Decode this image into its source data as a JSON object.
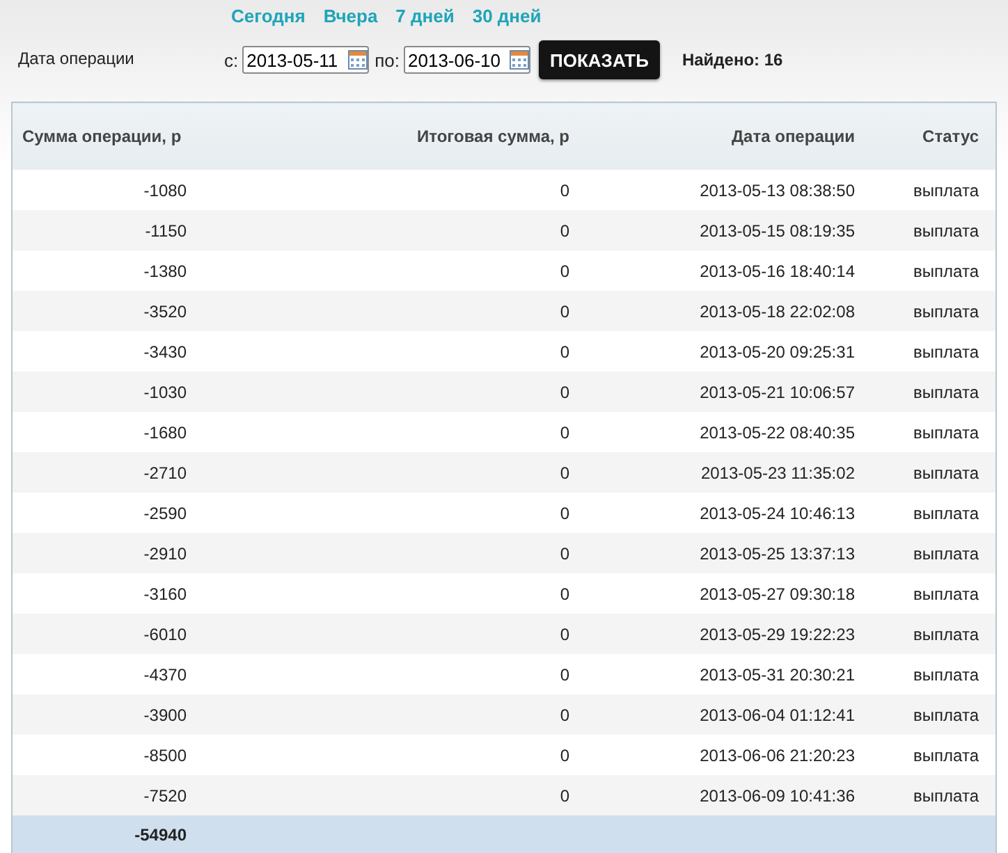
{
  "quick_links": [
    {
      "label": "Сегодня"
    },
    {
      "label": "Вчера"
    },
    {
      "label": "7 дней"
    },
    {
      "label": "30 дней"
    }
  ],
  "filter": {
    "label": "Дата операции",
    "from_label": "с:",
    "from_value": "2013-05-11",
    "to_label": "по:",
    "to_value": "2013-06-10",
    "button": "ПОКАЗАТЬ",
    "found": "Найдено: 16"
  },
  "table": {
    "columns": [
      "Сумма операции, р",
      "Итоговая сумма, р",
      "Дата операции",
      "Статус"
    ],
    "rows": [
      [
        "-1080",
        "0",
        "2013-05-13 08:38:50",
        "выплата"
      ],
      [
        "-1150",
        "0",
        "2013-05-15 08:19:35",
        "выплата"
      ],
      [
        "-1380",
        "0",
        "2013-05-16 18:40:14",
        "выплата"
      ],
      [
        "-3520",
        "0",
        "2013-05-18 22:02:08",
        "выплата"
      ],
      [
        "-3430",
        "0",
        "2013-05-20 09:25:31",
        "выплата"
      ],
      [
        "-1030",
        "0",
        "2013-05-21 10:06:57",
        "выплата"
      ],
      [
        "-1680",
        "0",
        "2013-05-22 08:40:35",
        "выплата"
      ],
      [
        "-2710",
        "0",
        "2013-05-23 11:35:02",
        "выплата"
      ],
      [
        "-2590",
        "0",
        "2013-05-24 10:46:13",
        "выплата"
      ],
      [
        "-2910",
        "0",
        "2013-05-25 13:37:13",
        "выплата"
      ],
      [
        "-3160",
        "0",
        "2013-05-27 09:30:18",
        "выплата"
      ],
      [
        "-6010",
        "0",
        "2013-05-29 19:22:23",
        "выплата"
      ],
      [
        "-4370",
        "0",
        "2013-05-31 20:30:21",
        "выплата"
      ],
      [
        "-3900",
        "0",
        "2013-06-04 01:12:41",
        "выплата"
      ],
      [
        "-8500",
        "0",
        "2013-06-06 21:20:23",
        "выплата"
      ],
      [
        "-7520",
        "0",
        "2013-06-09 10:41:36",
        "выплата"
      ]
    ],
    "total": "-54940"
  }
}
